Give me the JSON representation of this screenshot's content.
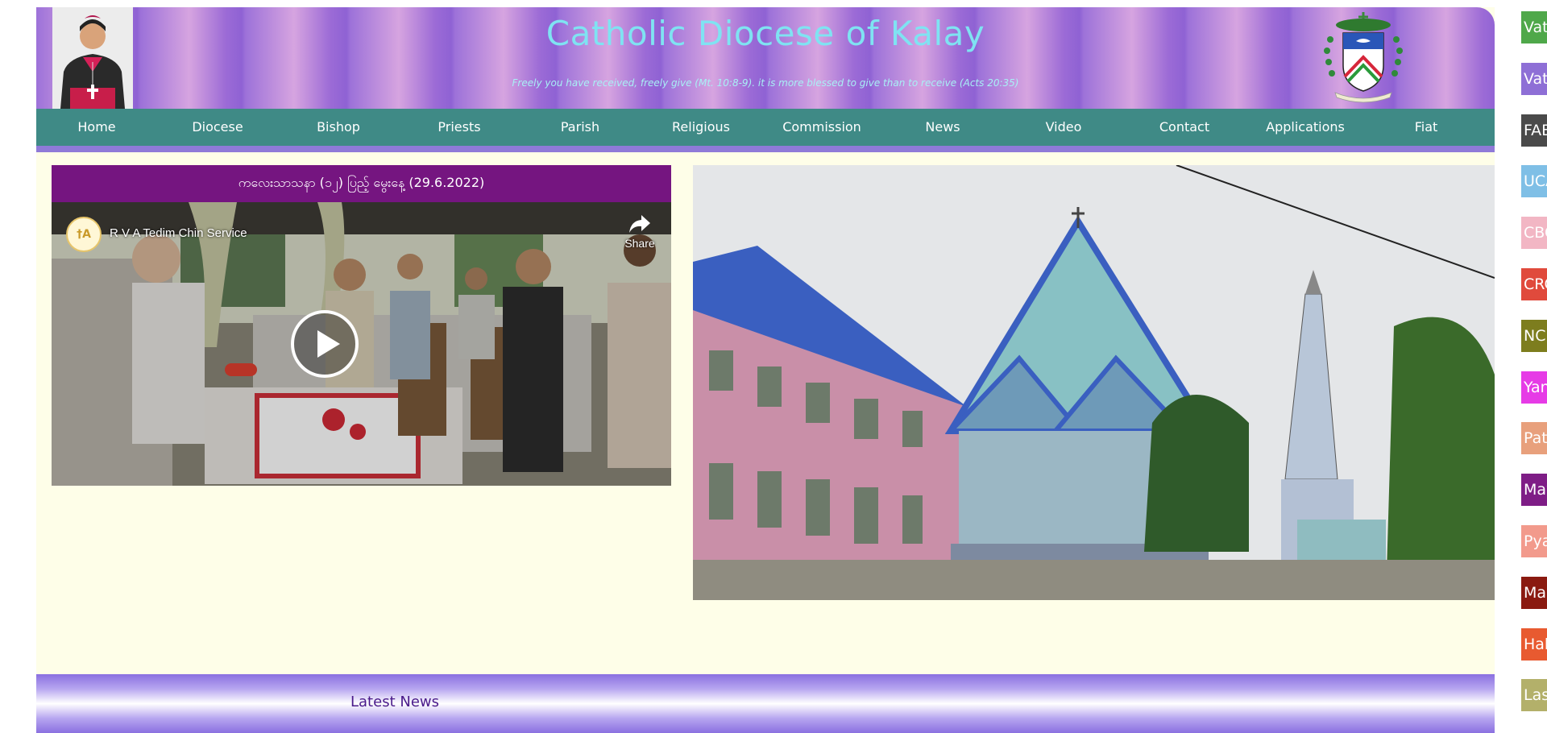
{
  "header": {
    "title": "Catholic Diocese of Kalay",
    "tagline": "Freely you have received, freely give (Mt. 10:8-9). it is more blessed to give than to receive (Acts 20:35)"
  },
  "nav": {
    "items": [
      {
        "label": "Home"
      },
      {
        "label": "Diocese"
      },
      {
        "label": "Bishop"
      },
      {
        "label": "Priests"
      },
      {
        "label": "Parish"
      },
      {
        "label": "Religious"
      },
      {
        "label": "Commission"
      },
      {
        "label": "News"
      },
      {
        "label": "Video"
      },
      {
        "label": "Contact"
      },
      {
        "label": "Applications"
      },
      {
        "label": "Fiat"
      }
    ]
  },
  "video": {
    "title": "ကလေးသာသနာ (၁၂) ပြည့် မွေးနေ့ (29.6.2022)",
    "channel_name": "R V A Tedim Chin Service",
    "share_label": "Share"
  },
  "latest_news": {
    "label": "Latest News"
  },
  "side_links": [
    {
      "label": "Vat",
      "color": "#4fa84a"
    },
    {
      "label": "Vat",
      "color": "#8e6fd6"
    },
    {
      "label": "FAE",
      "color": "#4a4a4a"
    },
    {
      "label": "UCA",
      "color": "#7fbfe6"
    },
    {
      "label": "CBC",
      "color": "#f2b6c4"
    },
    {
      "label": "CRC",
      "color": "#e04a3c"
    },
    {
      "label": "NCI",
      "color": "#7d7d1e"
    },
    {
      "label": "Yan",
      "color": "#e63be6"
    },
    {
      "label": "Pat",
      "color": "#e8a07c"
    },
    {
      "label": "Maw",
      "color": "#7e1d86"
    },
    {
      "label": "Pya",
      "color": "#f29a8c"
    },
    {
      "label": "Mar",
      "color": "#8a1a10"
    },
    {
      "label": "Hak",
      "color": "#e85a30"
    },
    {
      "label": "Las",
      "color": "#b3b06a"
    }
  ]
}
